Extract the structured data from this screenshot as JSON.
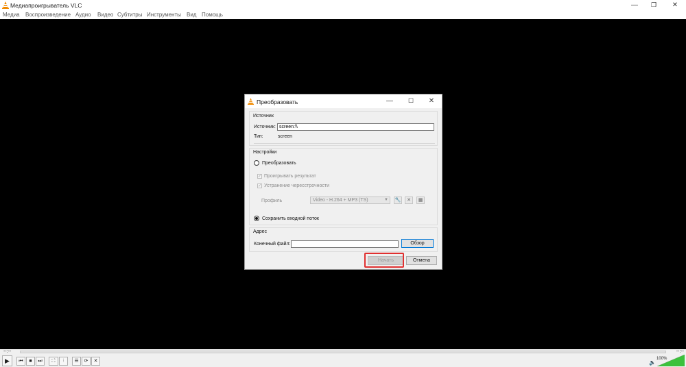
{
  "window": {
    "title": "Медиапроигрыватель VLC",
    "minimize_glyph": "—",
    "maximize_glyph": "❐",
    "close_glyph": "✕"
  },
  "menu": [
    "Медиа",
    "Воспроизведение",
    "Аудио",
    "Видео",
    "Субтитры",
    "Инструменты",
    "Вид",
    "Помощь"
  ],
  "dialog": {
    "title": "Преобразовать",
    "source_group": {
      "title": "Источник",
      "source_label": "Источник:",
      "source_value": "screen:\\\\",
      "type_label": "Тип:",
      "type_value": "screen"
    },
    "settings_group": {
      "title": "Настройки",
      "convert_label": "Преобразовать",
      "convert_selected": false,
      "play_result_label": "Проигрывать результат",
      "deinterlace_label": "Устранение чересстрочности",
      "profile_label": "Профиль",
      "profile_value": "Video - H.264 + MP3 (TS)",
      "dump_raw_label": "Сохранить входной поток",
      "dump_raw_selected": true
    },
    "destination_group": {
      "title": "Адрес",
      "file_label": "Конечный файл:",
      "file_value": "",
      "browse_label": "Обзор"
    },
    "start_label": "Начать",
    "cancel_label": "Отмена"
  },
  "player": {
    "time_elapsed": "--:--",
    "time_total": "--:--",
    "volume": "100%",
    "volume_level": 1.0
  },
  "colors": {
    "highlight": "#e03030",
    "vlc_orange": "#f18a00",
    "volume_green": "#3cc13c"
  }
}
